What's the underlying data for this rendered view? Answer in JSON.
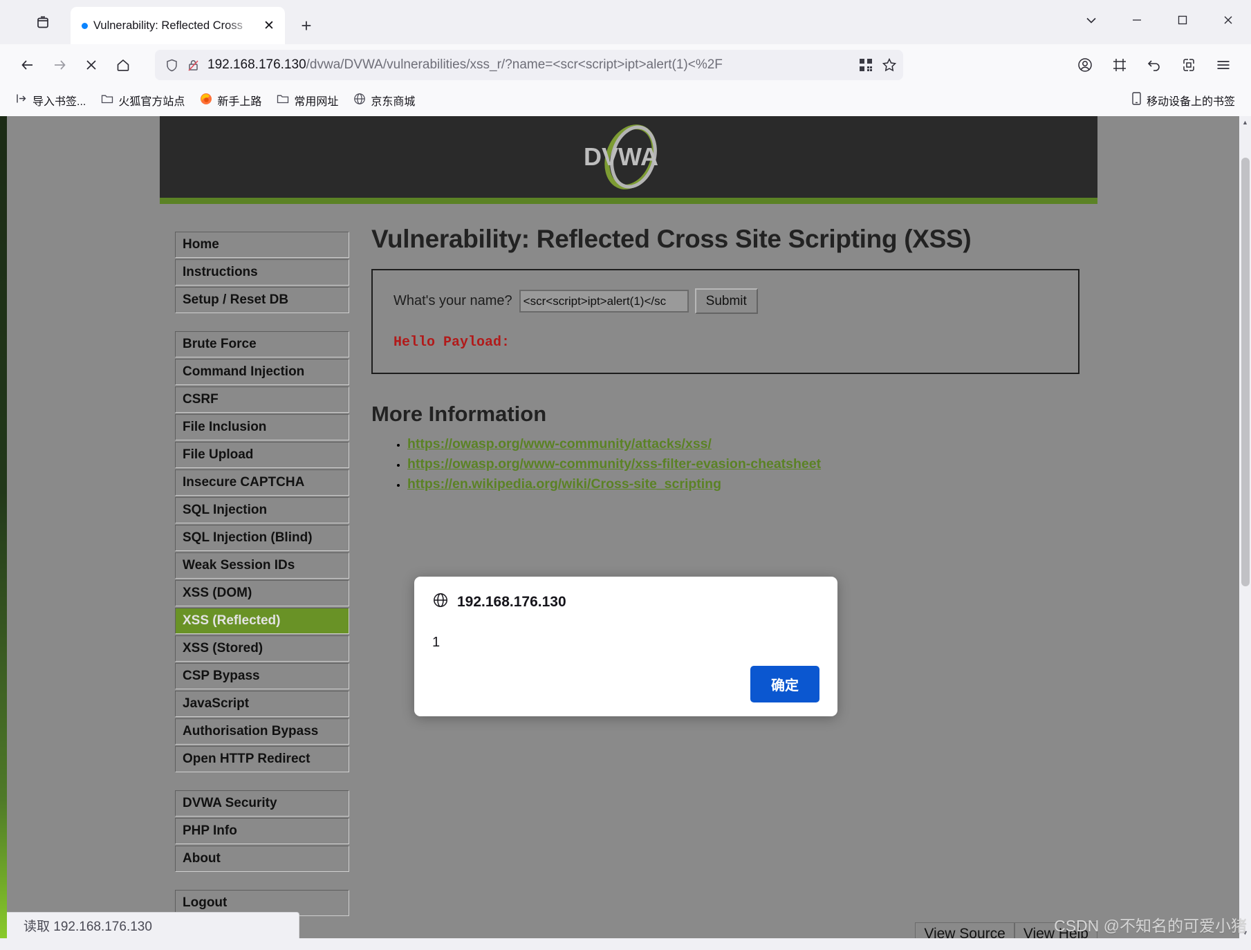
{
  "window": {
    "controls": {
      "tab_list_label": "v",
      "minimize_label": "–",
      "maximize_label": "□",
      "close_label": "✕"
    }
  },
  "tabbar": {
    "tab_title": "Vulnerability: Reflected Cross",
    "close_tab_label": "✕",
    "new_tab_label": "+"
  },
  "toolbar": {
    "back_label": "←",
    "forward_label": "→",
    "stop_label": "✕",
    "home_label": "⌂"
  },
  "urlbar": {
    "host": "192.168.176.130",
    "path": "/dvwa/DVWA/vulnerabilities/xss_r/?name=<scr<script>ipt>alert(1)<%2F"
  },
  "bookmarks": {
    "items": [
      {
        "label": "导入书签...",
        "icon": "import-icon"
      },
      {
        "label": "火狐官方站点",
        "icon": "folder-icon"
      },
      {
        "label": "新手上路",
        "icon": "firefox-icon"
      },
      {
        "label": "常用网址",
        "icon": "folder-icon"
      },
      {
        "label": "京东商城",
        "icon": "globe-icon"
      }
    ],
    "mobile_label": "移动设备上的书签"
  },
  "dvwa": {
    "logo_text": "DVWA",
    "page_title": "Vulnerability: Reflected Cross Site Scripting (XSS)",
    "form": {
      "label": "What's your name?",
      "input_value": "<scr<script>ipt>alert(1)</sc",
      "submit_label": "Submit"
    },
    "hello_text": "Hello Payload:",
    "more_info_title": "More Information",
    "links": [
      "https://owasp.org/www-community/attacks/xss/",
      "https://owasp.org/www-community/xss-filter-evasion-cheatsheet",
      "https://en.wikipedia.org/wiki/Cross-site_scripting"
    ],
    "menu": [
      {
        "label": "Home",
        "active": false
      },
      {
        "label": "Instructions",
        "active": false
      },
      {
        "label": "Setup / Reset DB",
        "active": false
      }
    ],
    "menu2": [
      {
        "label": "Brute Force",
        "active": false
      },
      {
        "label": "Command Injection",
        "active": false
      },
      {
        "label": "CSRF",
        "active": false
      },
      {
        "label": "File Inclusion",
        "active": false
      },
      {
        "label": "File Upload",
        "active": false
      },
      {
        "label": "Insecure CAPTCHA",
        "active": false
      },
      {
        "label": "SQL Injection",
        "active": false
      },
      {
        "label": "SQL Injection (Blind)",
        "active": false
      },
      {
        "label": "Weak Session IDs",
        "active": false
      },
      {
        "label": "XSS (DOM)",
        "active": false
      },
      {
        "label": "XSS (Reflected)",
        "active": true
      },
      {
        "label": "XSS (Stored)",
        "active": false
      },
      {
        "label": "CSP Bypass",
        "active": false
      },
      {
        "label": "JavaScript",
        "active": false
      },
      {
        "label": "Authorisation Bypass",
        "active": false
      },
      {
        "label": "Open HTTP Redirect",
        "active": false
      }
    ],
    "menu3": [
      {
        "label": "DVWA Security",
        "active": false
      },
      {
        "label": "PHP Info",
        "active": false
      },
      {
        "label": "About",
        "active": false
      }
    ],
    "menu4": [
      {
        "label": "Logout",
        "active": false
      }
    ],
    "footer": {
      "view_source_label": "View Source",
      "view_help_label": "View Help"
    }
  },
  "modal": {
    "origin": "192.168.176.130",
    "message": "1",
    "ok_label": "确定"
  },
  "statusbar": {
    "text": "读取 192.168.176.130"
  },
  "watermark": {
    "text": "CSDN @不知名的可爱小猪"
  },
  "colors": {
    "dvwa_green": "#5b8225",
    "menu_active": "#699226",
    "hello_red": "#b11a1a",
    "modal_button": "#0b57d0"
  }
}
